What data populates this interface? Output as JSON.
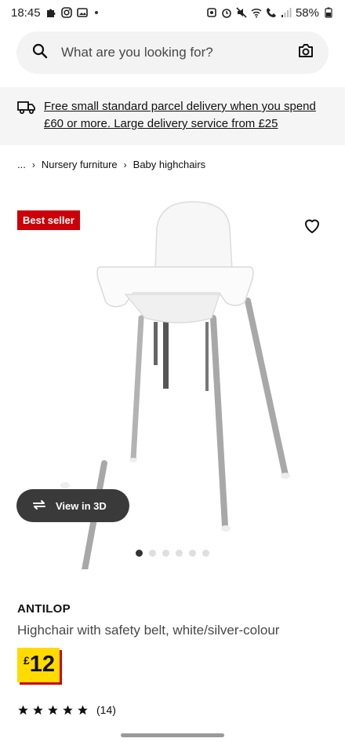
{
  "status_bar": {
    "time": "18:45",
    "battery": "58%"
  },
  "search": {
    "placeholder": "What are you looking for?"
  },
  "delivery": {
    "text": "Free small standard parcel delivery when you spend £60 or more. Large delivery service from £25"
  },
  "breadcrumb": {
    "ellipsis": "...",
    "items": [
      "Nursery furniture",
      "Baby highchairs"
    ]
  },
  "product": {
    "badge": "Best seller",
    "view_3d_label": "View in 3D",
    "name": "ANTILOP",
    "description": "Highchair with safety belt, white/silver-colour",
    "price_currency": "£",
    "price_value": "12",
    "rating_stars": 5,
    "rating_count": "(14)",
    "image_count": 6,
    "active_image": 1
  },
  "colors": {
    "badge_red": "#cc0008",
    "price_yellow": "#ffdb00",
    "search_bg": "#f3f3f3",
    "banner_bg": "#f5f5f5"
  }
}
